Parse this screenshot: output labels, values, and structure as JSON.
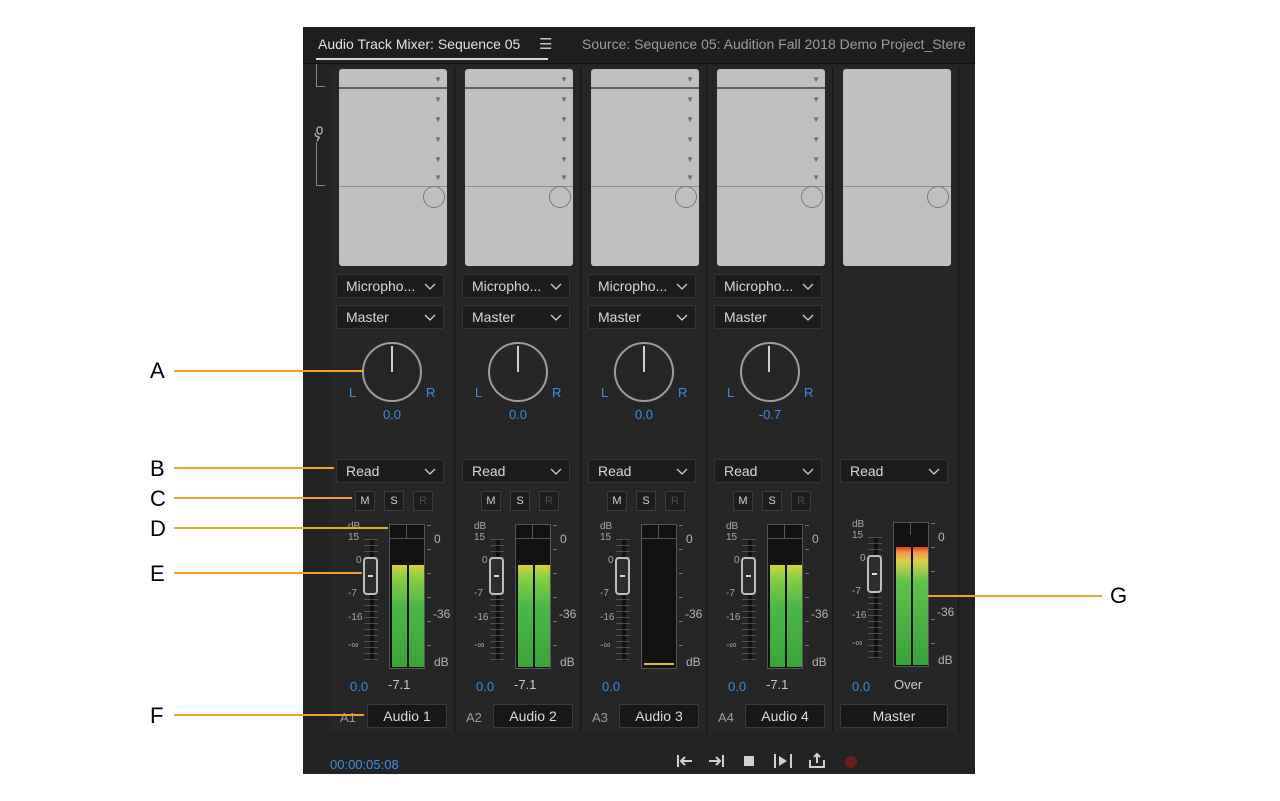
{
  "tabs": {
    "active_label": "Audio Track Mixer: Sequence 05",
    "second_label": "Source: Sequence 05: Audition Fall 2018 Demo Project_Stere"
  },
  "tracks": [
    {
      "input": "Micropho...",
      "output": "Master",
      "pan_l": "L",
      "pan_r": "R",
      "pan_value": "0.0",
      "automation": "Read",
      "m": "M",
      "s": "S",
      "r": "R",
      "db_label": "dB",
      "vol": "0.0",
      "peak": "-7.1",
      "id": "A1",
      "name": "Audio 1"
    },
    {
      "input": "Micropho...",
      "output": "Master",
      "pan_l": "L",
      "pan_r": "R",
      "pan_value": "0.0",
      "automation": "Read",
      "m": "M",
      "s": "S",
      "r": "R",
      "db_label": "dB",
      "vol": "0.0",
      "peak": "-7.1",
      "id": "A2",
      "name": "Audio 2"
    },
    {
      "input": "Micropho...",
      "output": "Master",
      "pan_l": "L",
      "pan_r": "R",
      "pan_value": "0.0",
      "automation": "Read",
      "m": "M",
      "s": "S",
      "r": "R",
      "db_label": "dB",
      "vol": "0.0",
      "peak": "",
      "id": "A3",
      "name": "Audio 3"
    },
    {
      "input": "Micropho...",
      "output": "Master",
      "pan_l": "L",
      "pan_r": "R",
      "pan_value": "-0.7",
      "automation": "Read",
      "m": "M",
      "s": "S",
      "r": "R",
      "db_label": "dB",
      "vol": "0.0",
      "peak": "-7.1",
      "id": "A4",
      "name": "Audio 4"
    },
    {
      "automation": "Read",
      "db_label": "dB",
      "vol": "0.0",
      "peak": "Over",
      "name": "Master"
    }
  ],
  "meter_levels": [
    0.8,
    0.8,
    0.0,
    0.8,
    0.92
  ],
  "fader_scale": {
    "t15": "15",
    "t0": "0",
    "t7": "-7",
    "t16": "-16",
    "tinf": "-∞"
  },
  "meter_scale": {
    "zero": "0",
    "mid": "-36",
    "db": "dB"
  },
  "transport": {
    "timecode": "00:00:05:08"
  },
  "icons": [
    "go-to-in-icon",
    "go-to-out-icon",
    "stop-icon",
    "play-in-to-out-icon",
    "loop-icon",
    "record-icon",
    "microphone-icon",
    "hamburger-menu-icon"
  ],
  "callouts": {
    "a": "A",
    "b": "B",
    "c": "C",
    "d": "D",
    "e": "E",
    "f": "F",
    "g": "G"
  },
  "colors": {
    "accent_blue": "#3a8ee6",
    "callout_line": "#f0a030",
    "record": "#6a1f1f"
  }
}
